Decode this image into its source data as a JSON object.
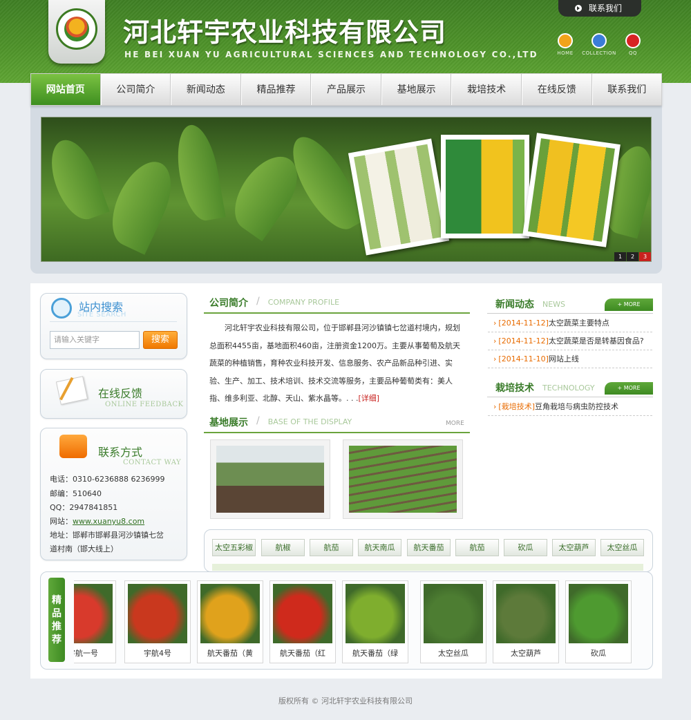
{
  "header": {
    "company_name": "河北轩宇农业科技有限公司",
    "company_en": "HE BEI XUAN YU AGRICULTURAL SCIENCES AND TECHNOLOGY CO.,LTD",
    "contact_tab": "联系我们",
    "quick_links": [
      {
        "label": "HOME",
        "icon": "home-icon",
        "color": "#f2a31a"
      },
      {
        "label": "COLLECTION",
        "icon": "mail-icon",
        "color": "#3b7dd8"
      },
      {
        "label": "QQ",
        "icon": "qq-icon",
        "color": "#d82323"
      }
    ]
  },
  "nav": {
    "items": [
      "网站首页",
      "公司简介",
      "新闻动态",
      "精品推荐",
      "产品展示",
      "基地展示",
      "栽培技术",
      "在线反馈",
      "联系我们"
    ],
    "active_index": 0
  },
  "banner": {
    "pages": [
      "1",
      "2",
      "3"
    ],
    "active_page": "3"
  },
  "sidebar": {
    "search": {
      "title": "站内搜索",
      "title_en": "SITE SEARCH",
      "placeholder": "请输入关键字",
      "button": "搜索"
    },
    "feedback": {
      "title": "在线反馈",
      "title_en": "ONLINE FEEDBACK"
    },
    "contact": {
      "title": "联系方式",
      "title_en": "CONTACT WAY",
      "phone": "电话：0310-6236888 6236999",
      "postcode": "邮编：510640",
      "qq": "QQ：2947841851",
      "website_label": "网站：",
      "website": "www.xuanyu8.com",
      "address_line1": "地址：邯郸市邯郸县河沙镇镇七岔",
      "address_line2": "道村南（邯大线上）"
    }
  },
  "profile": {
    "title": "公司简介",
    "title_en": "COMPANY PROFILE",
    "text": "河北轩宇农业科技有限公司，位于邯郸县河沙镇镇七岔道村境内，规划总面积4455亩，基地面积460亩，注册资金1200万。主要从事葡萄及航天蔬菜的种植销售，育种农业科技开发、信息服务、农产品新品种引进、实验、生产、加工、技术培训、技术交流等服务，主要品种葡萄类有：美人指、维多利亚、北醇、天山、紫水晶等。. . .",
    "more": "[详细]"
  },
  "base": {
    "title": "基地展示",
    "title_en": "BASE OF THE DISPLAY",
    "more": "MORE"
  },
  "news": {
    "title": "新闻动态",
    "title_en": "NEWS",
    "more": "+ MORE",
    "items": [
      {
        "date": "[2014-11-12]",
        "text": "太空蔬菜主要特点"
      },
      {
        "date": "[2014-11-12]",
        "text": "太空蔬菜是否是转基因食品?"
      },
      {
        "date": "[2014-11-10]",
        "text": "网站上线"
      }
    ]
  },
  "tech": {
    "title": "栽培技术",
    "title_en": "TECHNOLOGY",
    "more": "+ MORE",
    "items": [
      {
        "tag": "[栽培技术]",
        "text": "豆角栽培与病虫防控技术"
      }
    ]
  },
  "categories": [
    "太空五彩椒",
    "航椒",
    "航茄",
    "航天南瓜",
    "航天番茄",
    "航茄",
    "砍瓜",
    "太空葫芦",
    "太空丝瓜"
  ],
  "products": {
    "label": "精品推荐",
    "items": [
      {
        "name": "宇航一号",
        "color": "#d83a2c"
      },
      {
        "name": "宇航4号",
        "color": "#c9381e"
      },
      {
        "name": "航天番茄（黄",
        "color": "#e0a21c"
      },
      {
        "name": "航天番茄（红",
        "color": "#cf2a1c"
      },
      {
        "name": "航天番茄（绿",
        "color": "#7fae2e"
      },
      {
        "name": "太空丝瓜",
        "color": "#4d7d32"
      },
      {
        "name": "太空葫芦",
        "color": "#5d7a3a"
      },
      {
        "name": "砍瓜",
        "color": "#4e9a30"
      }
    ]
  },
  "footer": {
    "copyright": "版权所有 © 河北轩宇农业科技有限公司"
  }
}
